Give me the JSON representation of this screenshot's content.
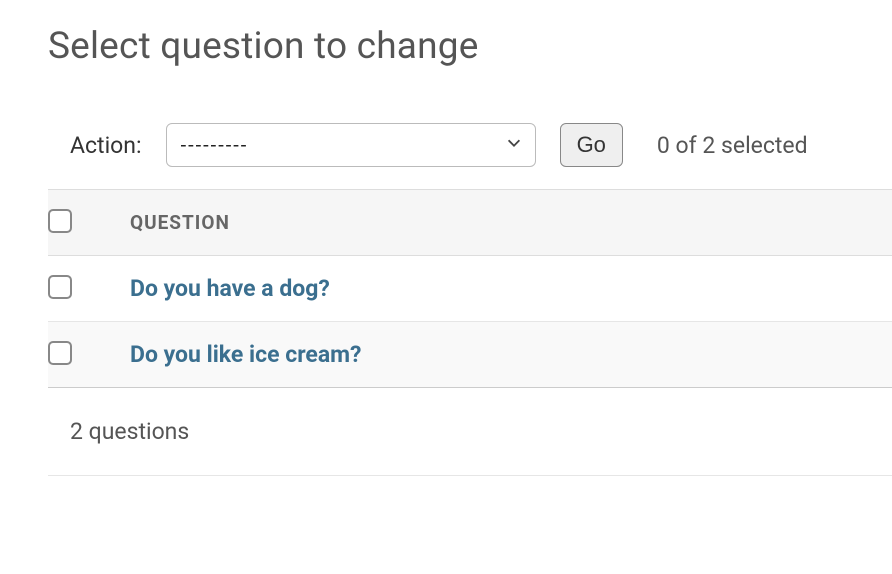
{
  "title": "Select question to change",
  "action_bar": {
    "label": "Action:",
    "select_placeholder": "---------",
    "go_label": "Go",
    "selection_text": "0 of 2 selected"
  },
  "columns": {
    "question": "Question"
  },
  "rows": [
    {
      "text": "Do you have a dog?"
    },
    {
      "text": "Do you like ice cream?"
    }
  ],
  "footer": "2 questions"
}
